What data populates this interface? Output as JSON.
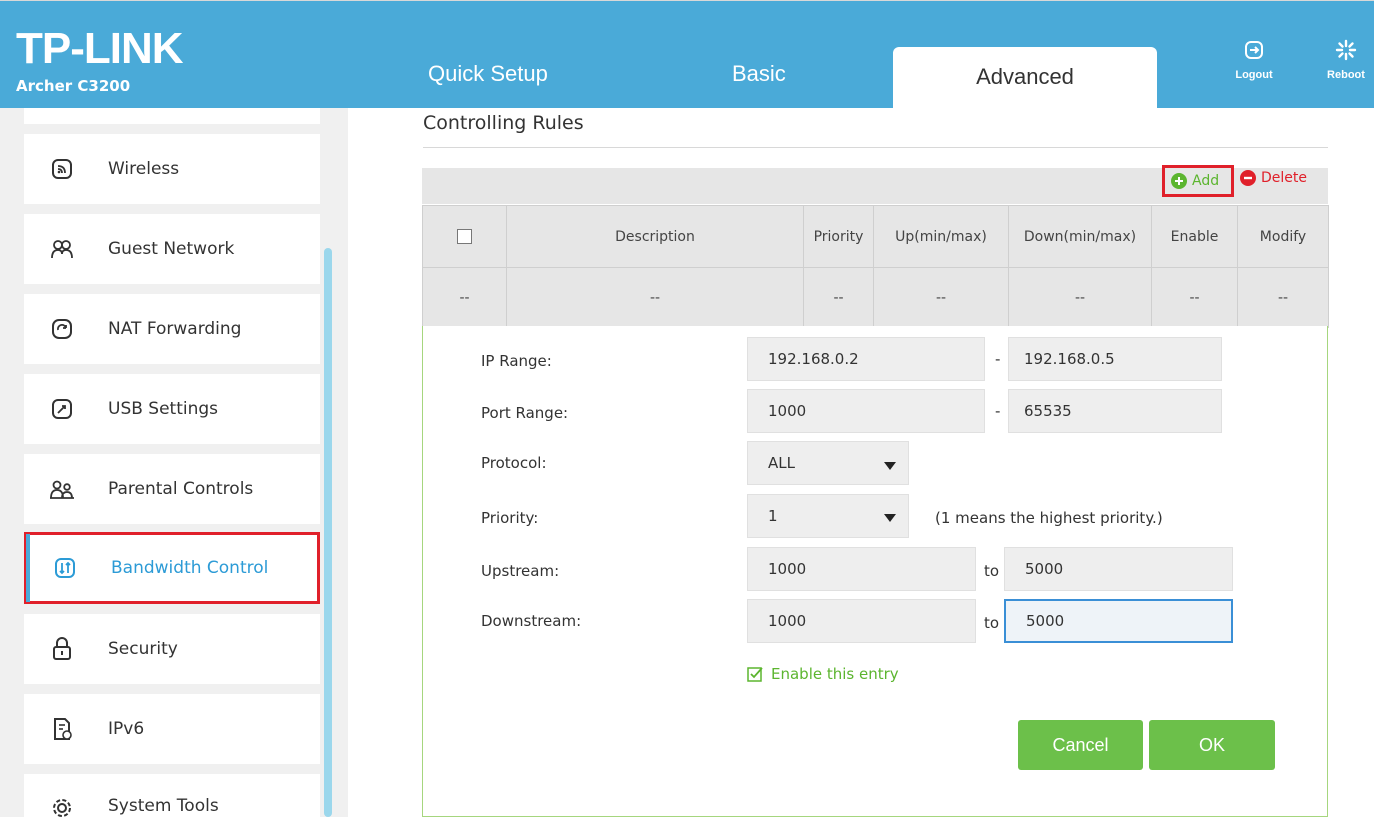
{
  "header": {
    "brand": "TP-LINK",
    "model": "Archer C3200",
    "tabs": [
      "Quick Setup",
      "Basic",
      "Advanced"
    ],
    "logout_label": "Logout",
    "reboot_label": "Reboot"
  },
  "sidebar": {
    "items": [
      {
        "label": "Wireless",
        "icon": "wireless-icon"
      },
      {
        "label": "Guest Network",
        "icon": "guest-network-icon"
      },
      {
        "label": "NAT Forwarding",
        "icon": "nat-forwarding-icon"
      },
      {
        "label": "USB Settings",
        "icon": "usb-settings-icon"
      },
      {
        "label": "Parental Controls",
        "icon": "parental-controls-icon"
      },
      {
        "label": "Bandwidth Control",
        "icon": "bandwidth-control-icon",
        "active": true
      },
      {
        "label": "Security",
        "icon": "lock-icon"
      },
      {
        "label": "IPv6",
        "icon": "ipv6-icon"
      },
      {
        "label": "System Tools",
        "icon": "gear-icon"
      }
    ]
  },
  "main": {
    "title": "Controlling Rules",
    "toolbar": {
      "add_label": "Add",
      "delete_label": "Delete"
    },
    "table": {
      "headers": [
        "Description",
        "Priority",
        "Up(min/max)",
        "Down(min/max)",
        "Enable",
        "Modify"
      ],
      "row": [
        "--",
        "--",
        "--",
        "--",
        "--",
        "--",
        "--"
      ]
    },
    "form": {
      "ip_range_label": "IP Range:",
      "ip_start": "192.168.0.2",
      "ip_end": "192.168.0.5",
      "port_range_label": "Port Range:",
      "port_start": "1000",
      "port_end": "65535",
      "protocol_label": "Protocol:",
      "protocol_value": "ALL",
      "priority_label": "Priority:",
      "priority_value": "1",
      "priority_note": "(1 means the highest priority.)",
      "upstream_label": "Upstream:",
      "upstream_min": "1000",
      "upstream_max": "5000",
      "downstream_label": "Downstream:",
      "downstream_min": "1000",
      "downstream_max": "5000",
      "dash": "-",
      "to": "to",
      "enable_entry_label": "Enable this entry",
      "cancel_label": "Cancel",
      "ok_label": "OK"
    }
  },
  "colors": {
    "header_blue": "#4aaad8",
    "button_green": "#6cc04a",
    "highlight_red": "#e0202a",
    "active_text": "#2c9bd6"
  }
}
